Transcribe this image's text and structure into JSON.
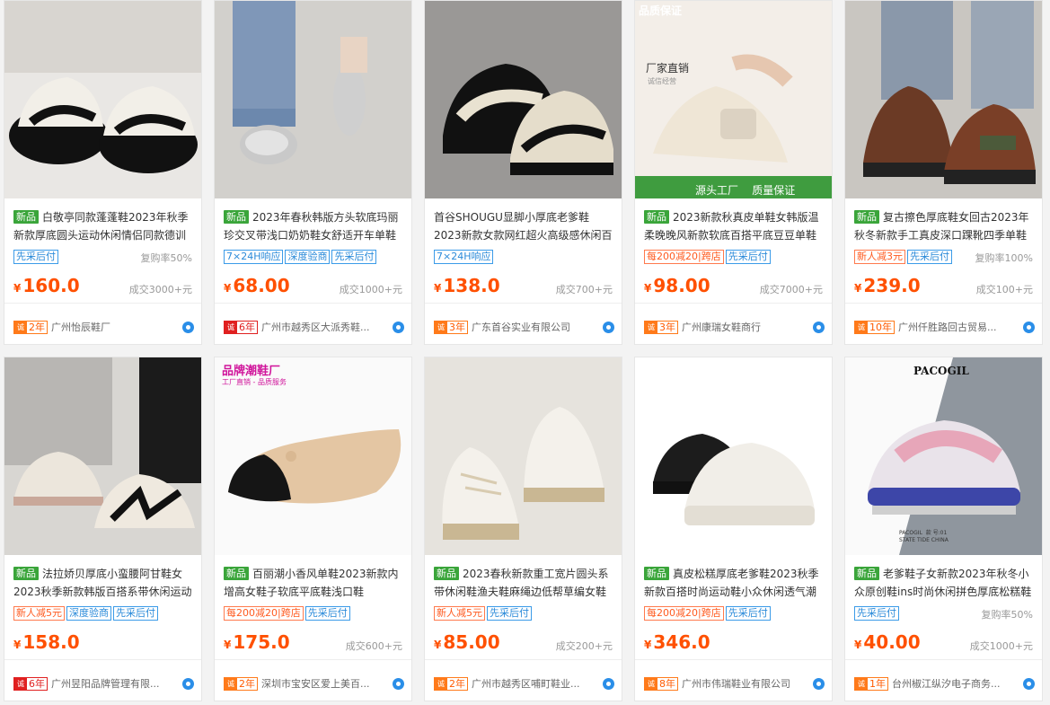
{
  "products": [
    {
      "new": "新品",
      "title": "白敬亭同款蓬蓬鞋2023年秋季新款厚底圆头运动休闲情侣同款德训",
      "tags": [
        {
          "text": "先采后付",
          "color": "blue"
        }
      ],
      "repeat_rate": "复购率50%",
      "price": "160.0",
      "sold": "成交3000+元",
      "years": "2年",
      "badge_color": "orange",
      "shop": "广州怡辰鞋厂",
      "image": "black-white-chunky-sneakers",
      "overlay": null
    },
    {
      "new": "新品",
      "title": "2023年春秋韩版方头软底玛丽珍交叉带浅口奶奶鞋女舒适开车单鞋",
      "tags": [
        {
          "text": "7×24H响应",
          "color": "blue"
        },
        {
          "text": "深度验商",
          "color": "blue"
        },
        {
          "text": "先采后付",
          "color": "blue"
        }
      ],
      "repeat_rate": "",
      "price": "68.00",
      "sold": "成交1000+元",
      "years": "6年",
      "badge_color": "red",
      "shop": "广州市越秀区大派秀鞋...",
      "image": "silver-ballet-flats",
      "overlay": null
    },
    {
      "new": "",
      "title": "首谷SHOUGU显脚小厚底老爹鞋2023新款女款网红超火高级感休闲百",
      "tags": [
        {
          "text": "7×24H响应",
          "color": "blue"
        }
      ],
      "repeat_rate": "",
      "price": "138.0",
      "sold": "成交700+元",
      "years": "3年",
      "badge_color": "orange",
      "shop": "广东首谷实业有限公司",
      "image": "black-beige-dad-sneakers",
      "overlay": null
    },
    {
      "new": "新品",
      "title": "2023新款秋真皮单鞋女韩版温柔晚晚风新款软底百搭平底豆豆单鞋",
      "tags": [
        {
          "text": "每200减20|跨店",
          "color": "red"
        },
        {
          "text": "先采后付",
          "color": "blue"
        }
      ],
      "repeat_rate": "",
      "price": "98.00",
      "sold": "成交7000+元",
      "years": "3年",
      "badge_color": "orange",
      "shop": "广州康瑞女鞋商行",
      "image": "cream-loafer",
      "overlay": {
        "top": "品质保证",
        "mid": "厂家直销",
        "mid_sub": "诚信经营",
        "bottom": "源头工厂    质量保证"
      }
    },
    {
      "new": "新品",
      "title": "复古擦色厚底鞋女回古2023年秋冬新款手工真皮深口踝靴四季单鞋",
      "tags": [
        {
          "text": "新人减3元",
          "color": "red"
        },
        {
          "text": "先采后付",
          "color": "blue"
        }
      ],
      "repeat_rate": "复购率100%",
      "price": "239.0",
      "sold": "成交100+元",
      "years": "10年",
      "badge_color": "orange",
      "shop": "广州仟胜路回古贸易...",
      "image": "brown-platform-loafer",
      "overlay": null
    },
    {
      "new": "新品",
      "title": "法拉娇贝厚底小蛮腰阿甘鞋女2023秋季新款韩版百搭系带休闲运动",
      "tags": [
        {
          "text": "新人减5元",
          "color": "red"
        },
        {
          "text": "深度验商",
          "color": "blue"
        },
        {
          "text": "先采后付",
          "color": "blue"
        }
      ],
      "repeat_rate": "",
      "price": "158.0",
      "sold": "",
      "years": "6年",
      "badge_color": "red",
      "shop": "广州昱阳品牌管理有限...",
      "image": "white-gump-sneakers",
      "overlay": null
    },
    {
      "new": "新品",
      "title": "百丽潮小香风单鞋2023新款内增高女鞋子软底平底鞋浅口鞋",
      "tags": [
        {
          "text": "每200减20|跨店",
          "color": "red"
        },
        {
          "text": "先采后付",
          "color": "blue"
        }
      ],
      "repeat_rate": "",
      "price": "175.0",
      "sold": "成交600+元",
      "years": "2年",
      "badge_color": "orange",
      "shop": "深圳市宝安区爱上美百...",
      "image": "beige-black-flat",
      "overlay": {
        "top": "品牌潮鞋厂",
        "sub": "工厂直销 - 品质服务"
      }
    },
    {
      "new": "新品",
      "title": "2023春秋新款重工宽片圆头系带休闲鞋渔夫鞋麻绳边低帮草编女鞋",
      "tags": [
        {
          "text": "新人减5元",
          "color": "red"
        },
        {
          "text": "先采后付",
          "color": "blue"
        }
      ],
      "repeat_rate": "",
      "price": "85.00",
      "sold": "成交200+元",
      "years": "2年",
      "badge_color": "orange",
      "shop": "广州市越秀区哺町鞋业...",
      "image": "white-espadrille-sneakers",
      "overlay": null
    },
    {
      "new": "新品",
      "title": "真皮松糕厚底老爹鞋2023秋季新款百搭时尚运动鞋小众休闲透气潮",
      "tags": [
        {
          "text": "每200减20|跨店",
          "color": "red"
        },
        {
          "text": "先采后付",
          "color": "blue"
        }
      ],
      "repeat_rate": "",
      "price": "346.0",
      "sold": "",
      "years": "8年",
      "badge_color": "orange",
      "shop": "广州市伟瑞鞋业有限公司",
      "image": "white-black-chunky-sneakers",
      "overlay": null
    },
    {
      "new": "新品",
      "title": "老爹鞋子女新款2023年秋冬小众原创鞋ins时尚休闲拼色厚底松糕鞋",
      "tags": [
        {
          "text": "先采后付",
          "color": "blue"
        }
      ],
      "repeat_rate": "复购率50%",
      "price": "40.00",
      "sold": "成交1000+元",
      "years": "1年",
      "badge_color": "orange",
      "shop": "台州椒江纵汐电子商务...",
      "image": "pink-blue-sneaker",
      "overlay": {
        "top": "PACOGIL",
        "sub": "PACOGIL  款 号:01",
        "sub2": "STATE TIDE CHINA"
      }
    }
  ],
  "currency": "¥",
  "trust_badge": "诚"
}
